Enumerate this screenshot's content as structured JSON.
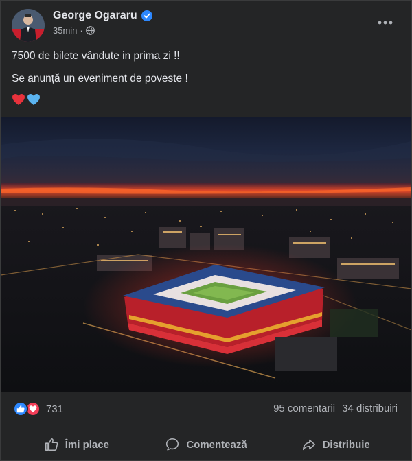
{
  "post": {
    "author": "George Ogararu",
    "time": "35min",
    "separator": "·",
    "line1": "7500 de bilete vândute in prima zi !!",
    "line2": "Se anunță un eveniment de poveste !",
    "emojis": [
      "red-heart",
      "blue-heart"
    ]
  },
  "stats": {
    "reaction_count": "731",
    "comments": "95 comentarii",
    "shares": "34 distribuiri"
  },
  "actions": {
    "like": "Îmi place",
    "comment": "Comentează",
    "share": "Distribuie"
  },
  "colors": {
    "background": "#242526",
    "text": "#e4e6eb",
    "secondary_text": "#b0b3b8",
    "verified_blue": "#2d88ff",
    "like_blue": "#2d88ff",
    "love_red": "#f33e58"
  }
}
